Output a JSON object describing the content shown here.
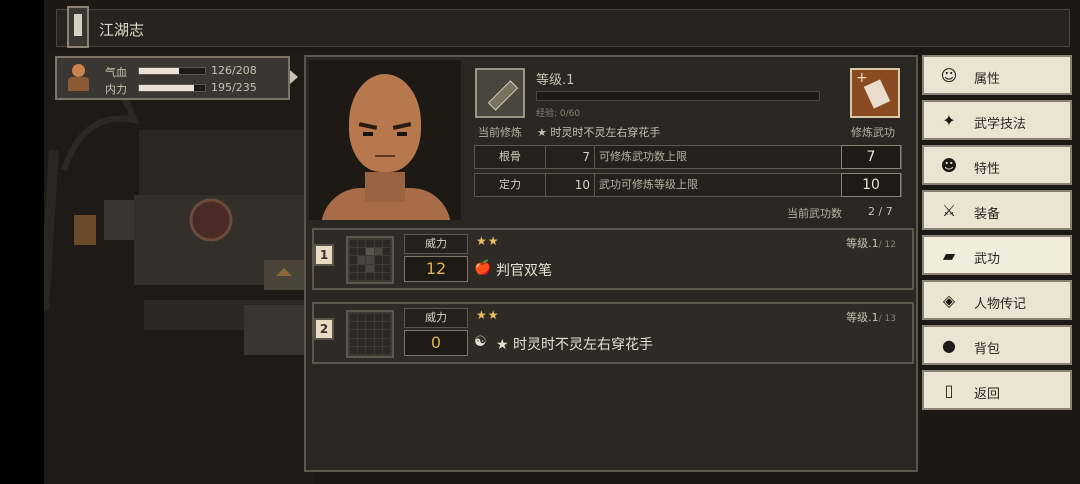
{
  "window_title": "江湖志",
  "status": {
    "hp_label": "气血",
    "hp_value": "126/208",
    "hp_fraction": 0.606,
    "mp_label": "内力",
    "mp_value": "195/235",
    "mp_fraction": 0.83
  },
  "manual": {
    "level_label": "等级.1",
    "xp_text": "经验: 0/60",
    "current_label": "当前修炼",
    "current_name": "★ 时灵时不灵左右穿花手",
    "practice_label": "修炼武功",
    "stats": [
      {
        "name": "根骨",
        "value": "7",
        "desc": "可修炼武功数上限",
        "cap": "7"
      },
      {
        "name": "定力",
        "value": "10",
        "desc": "武功可修炼等级上限",
        "cap": "10"
      }
    ],
    "count_label": "当前武功数",
    "count_value": "2 / 7"
  },
  "skills": [
    {
      "index": "1",
      "power_label": "威力",
      "power": "12",
      "stars": "★★",
      "icon": "🍎",
      "name": "判官双笔",
      "level": "等级.1",
      "level_max": "/ 12"
    },
    {
      "index": "2",
      "power_label": "威力",
      "power": "0",
      "stars": "★★",
      "icon": "☯",
      "name": "★ 时灵时不灵左右穿花手",
      "level": "等级.1",
      "level_max": "/ 13"
    }
  ],
  "menu": [
    {
      "label": "属性",
      "icon": "person-icon",
      "glyph": "☺"
    },
    {
      "label": "武学技法",
      "icon": "martial-skill-icon",
      "glyph": "✦"
    },
    {
      "label": "特性",
      "icon": "trait-icon",
      "glyph": "☻"
    },
    {
      "label": "装备",
      "icon": "sword-icon",
      "glyph": "⚔"
    },
    {
      "label": "武功",
      "icon": "manual-book-icon",
      "glyph": "▰"
    },
    {
      "label": "人物传记",
      "icon": "biography-icon",
      "glyph": "◈"
    },
    {
      "label": "背包",
      "icon": "bag-icon",
      "glyph": "●"
    },
    {
      "label": "返回",
      "icon": "door-icon",
      "glyph": "▯"
    }
  ]
}
